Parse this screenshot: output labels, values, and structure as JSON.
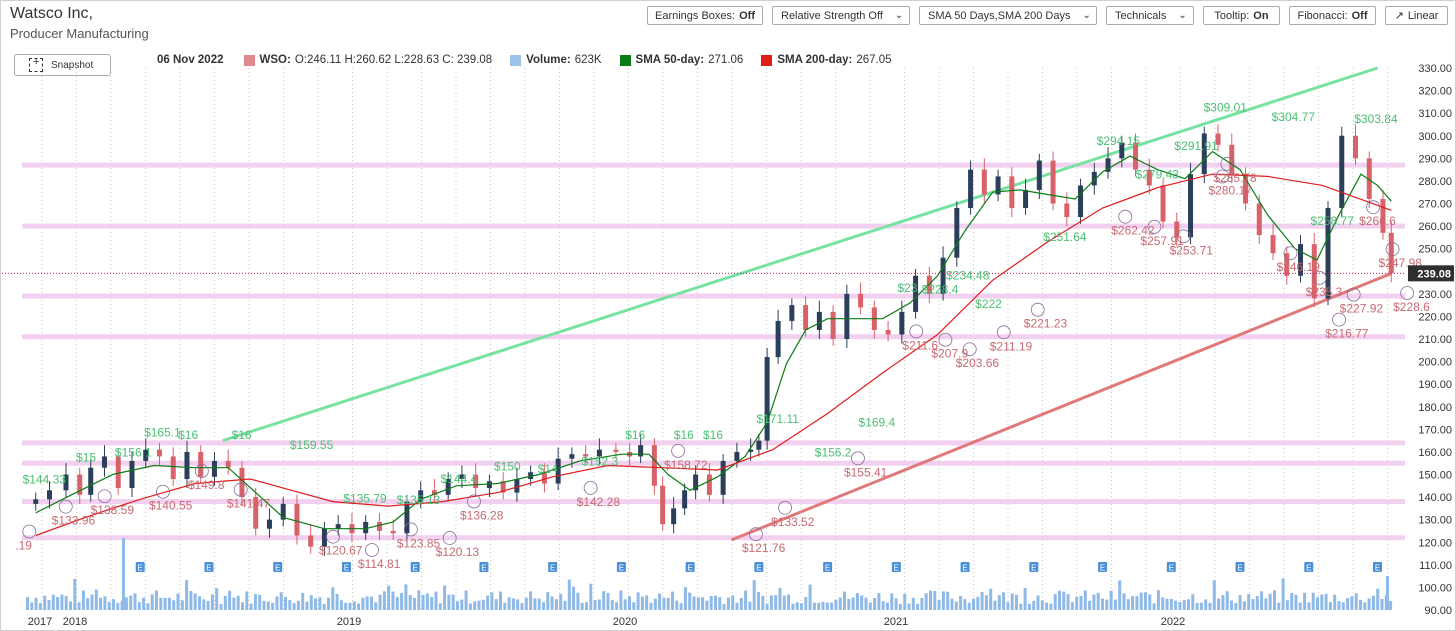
{
  "header": {
    "company": "Watsco Inc,",
    "industry": "Producer Manufacturing"
  },
  "toolbar": {
    "earnings": {
      "label": "Earnings Boxes:",
      "value": "Off"
    },
    "relstrength": {
      "label": "Relative Strength Off"
    },
    "sma": {
      "label": "SMA 50 Days,SMA 200 Days"
    },
    "technicals": {
      "label": "Technicals"
    },
    "tooltip": {
      "label": "Tooltip:",
      "value": "On"
    },
    "fibonacci": {
      "label": "Fibonacci:",
      "value": "Off"
    },
    "scale": {
      "label": "Linear",
      "icon": "arrow-up-right-icon"
    }
  },
  "snapshot_label": "Snapshot",
  "legend": {
    "date": "06 Nov 2022",
    "ticker_label": "WSO:",
    "ohlc": "O:246.11 H:260.62 L:228.63 C: 239.08",
    "volume_label": "Volume:",
    "volume_value": "623K",
    "sma50_label": "SMA 50-day:",
    "sma50_value": "271.06",
    "sma200_label": "SMA 200-day:",
    "sma200_value": "267.05"
  },
  "colors": {
    "candle_up": "#2b3f5a",
    "candle_down": "#d9616a",
    "volume": "#8fb9e6",
    "sma50": "#0a7d14",
    "sma200": "#e21b1b",
    "peak_label": "#4bbf73",
    "trough_label": "#c86a72",
    "support_band": "#f0c8ec",
    "upper_trend": "#78e3a0",
    "lower_trend": "#e07a7a",
    "last_price_tag": "#2f2f2f",
    "earnings_marker": "#4a90d9"
  },
  "chart_data": {
    "type": "line",
    "title": "",
    "ylim": [
      90,
      330
    ],
    "y_ticks": [
      "330.00",
      "320.00",
      "310.00",
      "300.00",
      "290.00",
      "280.00",
      "270.00",
      "260.00",
      "250.00",
      "240.00",
      "230.00",
      "220.00",
      "210.00",
      "200.00",
      "190.00",
      "180.00",
      "170.00",
      "160.00",
      "150.00",
      "140.00",
      "130.00",
      "120.00",
      "110.00",
      "100.00",
      "90.00"
    ],
    "x_tick_labels": [
      {
        "label": "2017",
        "t": 2017.95
      },
      {
        "label": "2018",
        "t": 2018.0
      },
      {
        "label": "2019",
        "t": 2019.0
      },
      {
        "label": "2020",
        "t": 2020.0
      },
      {
        "label": "2021",
        "t": 2021.0
      },
      {
        "label": "2022",
        "t": 2022.0
      }
    ],
    "last_price": "239.08",
    "last_price_value": 239.08,
    "close_series": [
      [
        2017.92,
        139
      ],
      [
        2017.97,
        143
      ],
      [
        2018.03,
        150
      ],
      [
        2018.08,
        141
      ],
      [
        2018.12,
        153
      ],
      [
        2018.17,
        158
      ],
      [
        2018.22,
        144
      ],
      [
        2018.27,
        156
      ],
      [
        2018.32,
        161
      ],
      [
        2018.37,
        158
      ],
      [
        2018.42,
        148
      ],
      [
        2018.47,
        160
      ],
      [
        2018.52,
        149
      ],
      [
        2018.57,
        156
      ],
      [
        2018.62,
        153
      ],
      [
        2018.67,
        140
      ],
      [
        2018.72,
        126
      ],
      [
        2018.77,
        130
      ],
      [
        2018.82,
        137
      ],
      [
        2018.87,
        123
      ],
      [
        2018.92,
        118
      ],
      [
        2018.97,
        126
      ],
      [
        2019.02,
        128
      ],
      [
        2019.07,
        124
      ],
      [
        2019.12,
        129
      ],
      [
        2019.17,
        125
      ],
      [
        2019.22,
        124
      ],
      [
        2019.27,
        138
      ],
      [
        2019.32,
        143
      ],
      [
        2019.37,
        141
      ],
      [
        2019.42,
        148
      ],
      [
        2019.47,
        150
      ],
      [
        2019.52,
        144
      ],
      [
        2019.57,
        147
      ],
      [
        2019.62,
        142
      ],
      [
        2019.67,
        148
      ],
      [
        2019.72,
        151
      ],
      [
        2019.77,
        146
      ],
      [
        2019.82,
        157
      ],
      [
        2019.87,
        159
      ],
      [
        2019.92,
        158
      ],
      [
        2019.97,
        161
      ],
      [
        2020.03,
        160
      ],
      [
        2020.08,
        158
      ],
      [
        2020.12,
        163
      ],
      [
        2020.17,
        145
      ],
      [
        2020.2,
        128
      ],
      [
        2020.24,
        135
      ],
      [
        2020.28,
        143
      ],
      [
        2020.32,
        150
      ],
      [
        2020.37,
        141
      ],
      [
        2020.42,
        156
      ],
      [
        2020.47,
        160
      ],
      [
        2020.52,
        161
      ],
      [
        2020.55,
        165
      ],
      [
        2020.58,
        202
      ],
      [
        2020.62,
        218
      ],
      [
        2020.67,
        225
      ],
      [
        2020.72,
        214
      ],
      [
        2020.77,
        222
      ],
      [
        2020.82,
        210
      ],
      [
        2020.87,
        230
      ],
      [
        2020.92,
        224
      ],
      [
        2020.97,
        214
      ],
      [
        2021.02,
        212
      ],
      [
        2021.07,
        222
      ],
      [
        2021.12,
        238
      ],
      [
        2021.17,
        230
      ],
      [
        2021.22,
        246
      ],
      [
        2021.27,
        268
      ],
      [
        2021.32,
        285
      ],
      [
        2021.37,
        274
      ],
      [
        2021.42,
        282
      ],
      [
        2021.47,
        268
      ],
      [
        2021.52,
        276
      ],
      [
        2021.57,
        289
      ],
      [
        2021.62,
        270
      ],
      [
        2021.67,
        264
      ],
      [
        2021.72,
        278
      ],
      [
        2021.77,
        284
      ],
      [
        2021.82,
        290
      ],
      [
        2021.87,
        297
      ],
      [
        2021.92,
        285
      ],
      [
        2021.97,
        278
      ],
      [
        2022.02,
        262
      ],
      [
        2022.07,
        255
      ],
      [
        2022.12,
        283
      ],
      [
        2022.17,
        301
      ],
      [
        2022.22,
        296
      ],
      [
        2022.27,
        283
      ],
      [
        2022.32,
        270
      ],
      [
        2022.37,
        256
      ],
      [
        2022.42,
        248
      ],
      [
        2022.47,
        238
      ],
      [
        2022.52,
        252
      ],
      [
        2022.57,
        228
      ],
      [
        2022.62,
        268
      ],
      [
        2022.67,
        300
      ],
      [
        2022.72,
        290
      ],
      [
        2022.77,
        272
      ],
      [
        2022.82,
        257
      ],
      [
        2022.85,
        239.08
      ]
    ],
    "series": [
      {
        "name": "SMA 50-day",
        "color": "#0a7d14",
        "points": [
          [
            2017.92,
            133
          ],
          [
            2018.05,
            141
          ],
          [
            2018.2,
            150
          ],
          [
            2018.35,
            154
          ],
          [
            2018.5,
            153
          ],
          [
            2018.62,
            153
          ],
          [
            2018.72,
            142
          ],
          [
            2018.82,
            131
          ],
          [
            2018.97,
            126
          ],
          [
            2019.12,
            126
          ],
          [
            2019.22,
            129
          ],
          [
            2019.32,
            139
          ],
          [
            2019.45,
            145
          ],
          [
            2019.6,
            146
          ],
          [
            2019.75,
            150
          ],
          [
            2019.9,
            156
          ],
          [
            2020.05,
            159
          ],
          [
            2020.15,
            159
          ],
          [
            2020.22,
            150
          ],
          [
            2020.3,
            143
          ],
          [
            2020.4,
            149
          ],
          [
            2020.5,
            158
          ],
          [
            2020.58,
            173
          ],
          [
            2020.65,
            199
          ],
          [
            2020.72,
            214
          ],
          [
            2020.8,
            219
          ],
          [
            2020.9,
            219
          ],
          [
            2021.0,
            219
          ],
          [
            2021.1,
            226
          ],
          [
            2021.2,
            238
          ],
          [
            2021.3,
            258
          ],
          [
            2021.4,
            275
          ],
          [
            2021.5,
            276
          ],
          [
            2021.6,
            274
          ],
          [
            2021.7,
            272
          ],
          [
            2021.8,
            284
          ],
          [
            2021.9,
            291
          ],
          [
            2022.0,
            285
          ],
          [
            2022.1,
            281
          ],
          [
            2022.2,
            293
          ],
          [
            2022.3,
            285
          ],
          [
            2022.4,
            265
          ],
          [
            2022.5,
            250
          ],
          [
            2022.58,
            245
          ],
          [
            2022.66,
            265
          ],
          [
            2022.74,
            283
          ],
          [
            2022.8,
            278
          ],
          [
            2022.85,
            271
          ]
        ]
      },
      {
        "name": "SMA 200-day",
        "color": "#e21b1b",
        "points": [
          [
            2017.92,
            123
          ],
          [
            2018.1,
            131
          ],
          [
            2018.3,
            139
          ],
          [
            2018.5,
            146
          ],
          [
            2018.7,
            148
          ],
          [
            2018.85,
            143
          ],
          [
            2019.0,
            138
          ],
          [
            2019.2,
            136
          ],
          [
            2019.4,
            138
          ],
          [
            2019.6,
            142
          ],
          [
            2019.8,
            149
          ],
          [
            2020.0,
            154
          ],
          [
            2020.2,
            153
          ],
          [
            2020.4,
            152
          ],
          [
            2020.6,
            161
          ],
          [
            2020.8,
            177
          ],
          [
            2021.0,
            195
          ],
          [
            2021.2,
            212
          ],
          [
            2021.4,
            236
          ],
          [
            2021.6,
            253
          ],
          [
            2021.8,
            268
          ],
          [
            2022.0,
            277
          ],
          [
            2022.2,
            283
          ],
          [
            2022.4,
            282
          ],
          [
            2022.6,
            278
          ],
          [
            2022.85,
            267
          ]
        ]
      }
    ],
    "support_bands": [
      {
        "y": 287
      },
      {
        "y": 260
      },
      {
        "y": 229
      },
      {
        "y": 211
      },
      {
        "y": 164
      },
      {
        "y": 155
      },
      {
        "y": 138
      },
      {
        "y": 122
      }
    ],
    "trendlines": [
      {
        "name": "upper",
        "from": [
          2018.6,
          165
        ],
        "to": [
          2022.8,
          330
        ]
      },
      {
        "name": "lower",
        "from": [
          2020.45,
          121
        ],
        "to": [
          2022.85,
          239
        ]
      }
    ],
    "peak_labels": [
      {
        "text": "$144.33",
        "t": 2017.98,
        "v": 144.3
      },
      {
        "text": "$15",
        "t": 2018.2,
        "v": 154
      },
      {
        "text": "$156.1",
        "t": 2018.36,
        "v": 156.1
      },
      {
        "text": "$165.1",
        "t": 2018.48,
        "v": 165.1
      },
      {
        "text": "$16",
        "t": 2018.62,
        "v": 164
      },
      {
        "text": "$16",
        "t": 2018.84,
        "v": 164
      },
      {
        "text": "$159.55",
        "t": 2019.08,
        "v": 159.5
      },
      {
        "text": "$135.79",
        "t": 2019.3,
        "v": 135.8
      },
      {
        "text": "$135.13",
        "t": 2019.52,
        "v": 135.1
      },
      {
        "text": "$144.4",
        "t": 2019.7,
        "v": 144.4
      },
      {
        "text": "$150",
        "t": 2019.92,
        "v": 150
      },
      {
        "text": "$14",
        "t": 2020.1,
        "v": 149
      },
      {
        "text": "$152.3",
        "t": 2020.28,
        "v": 152.3
      },
      {
        "text": "$16",
        "t": 2020.46,
        "v": 164
      },
      {
        "text": "$16",
        "t": 2020.66,
        "v": 164
      },
      {
        "text": "$16",
        "t": 2020.78,
        "v": 164
      },
      {
        "text": "$171.11",
        "t": 2021.0,
        "v": 171.1
      },
      {
        "text": "$156.2",
        "t": 2021.24,
        "v": 156.2
      },
      {
        "text": "$169.4",
        "t": 2021.42,
        "v": 169.4
      },
      {
        "text": "$23",
        "t": 2021.58,
        "v": 229
      },
      {
        "text": "$228.4",
        "t": 2021.68,
        "v": 228.4
      },
      {
        "text": "$234.48",
        "t": 2021.78,
        "v": 234.5
      },
      {
        "text": "$222",
        "t": 2021.9,
        "v": 222
      },
      {
        "text": "$251.64",
        "t": 2022.18,
        "v": 251.6
      },
      {
        "text": "$294.15",
        "t": 2022.4,
        "v": 294.2
      },
      {
        "text": "$279.43",
        "t": 2022.56,
        "v": 279.4
      },
      {
        "text": "$291.91",
        "t": 2022.72,
        "v": 291.9
      },
      {
        "text": "$309.01",
        "t": 2022.84,
        "v": 309
      },
      {
        "text": "$304.77",
        "t": 2023.12,
        "v": 304.8
      },
      {
        "text": "$258.77",
        "t": 2023.28,
        "v": 258.8
      },
      {
        "text": "$303.84",
        "t": 2023.46,
        "v": 303.8
      }
    ],
    "trough_labels": [
      {
        "text": ".19",
        "t": 2017.95,
        "v": 123
      },
      {
        "text": "$133.96",
        "t": 2018.1,
        "v": 134
      },
      {
        "text": "$138.59",
        "t": 2018.26,
        "v": 138.6
      },
      {
        "text": "$140.55",
        "t": 2018.5,
        "v": 140.6
      },
      {
        "text": "$149.8",
        "t": 2018.66,
        "v": 149.8
      },
      {
        "text": "$141.47",
        "t": 2018.82,
        "v": 141.5
      },
      {
        "text": "$120.67",
        "t": 2019.2,
        "v": 120.7
      },
      {
        "text": "$114.81",
        "t": 2019.36,
        "v": 114.8
      },
      {
        "text": "$123.85",
        "t": 2019.52,
        "v": 123.9
      },
      {
        "text": "$120.13",
        "t": 2019.68,
        "v": 120.1
      },
      {
        "text": "$136.28",
        "t": 2019.78,
        "v": 136.3
      },
      {
        "text": "$142.28",
        "t": 2020.26,
        "v": 142.3
      },
      {
        "text": "$158.72",
        "t": 2020.62,
        "v": 158.7
      },
      {
        "text": "$121.76",
        "t": 2020.94,
        "v": 121.8
      },
      {
        "text": "$133.52",
        "t": 2021.06,
        "v": 133.5
      },
      {
        "text": "$155.41",
        "t": 2021.36,
        "v": 155.4
      },
      {
        "text": "$211.6",
        "t": 2021.6,
        "v": 211.6
      },
      {
        "text": "$207.9",
        "t": 2021.72,
        "v": 207.9
      },
      {
        "text": "$203.66",
        "t": 2021.82,
        "v": 203.7
      },
      {
        "text": "$211.19",
        "t": 2021.96,
        "v": 211.2
      },
      {
        "text": "$221.23",
        "t": 2022.1,
        "v": 221.2
      },
      {
        "text": "$262.42",
        "t": 2022.46,
        "v": 262.4
      },
      {
        "text": "$257.91",
        "t": 2022.58,
        "v": 257.9
      },
      {
        "text": "$253.71",
        "t": 2022.7,
        "v": 253.7
      },
      {
        "text": "$280.17",
        "t": 2022.86,
        "v": 280.2
      },
      {
        "text": "$285.78",
        "t": 2022.88,
        "v": 285.8
      },
      {
        "text": "$246.19",
        "t": 2023.14,
        "v": 246.2
      },
      {
        "text": "$235.3",
        "t": 2023.26,
        "v": 235.3
      },
      {
        "text": "$227.92",
        "t": 2023.4,
        "v": 227.9
      },
      {
        "text": "$216.77",
        "t": 2023.34,
        "v": 216.8
      },
      {
        "text": "$266.6",
        "t": 2023.48,
        "v": 266.6
      },
      {
        "text": "$247.98",
        "t": 2023.56,
        "v": 248
      },
      {
        "text": "$228.6",
        "t": 2023.62,
        "v": 228.6
      }
    ],
    "earnings_markers": [
      2018.3,
      2018.55,
      2018.8,
      2019.05,
      2019.3,
      2019.55,
      2019.8,
      2020.05,
      2020.3,
      2020.55,
      2020.8,
      2021.05,
      2021.3,
      2021.55,
      2021.8,
      2022.05,
      2022.3,
      2022.55,
      2022.8
    ],
    "earnings_marker_label": "E",
    "volume_series": []
  }
}
